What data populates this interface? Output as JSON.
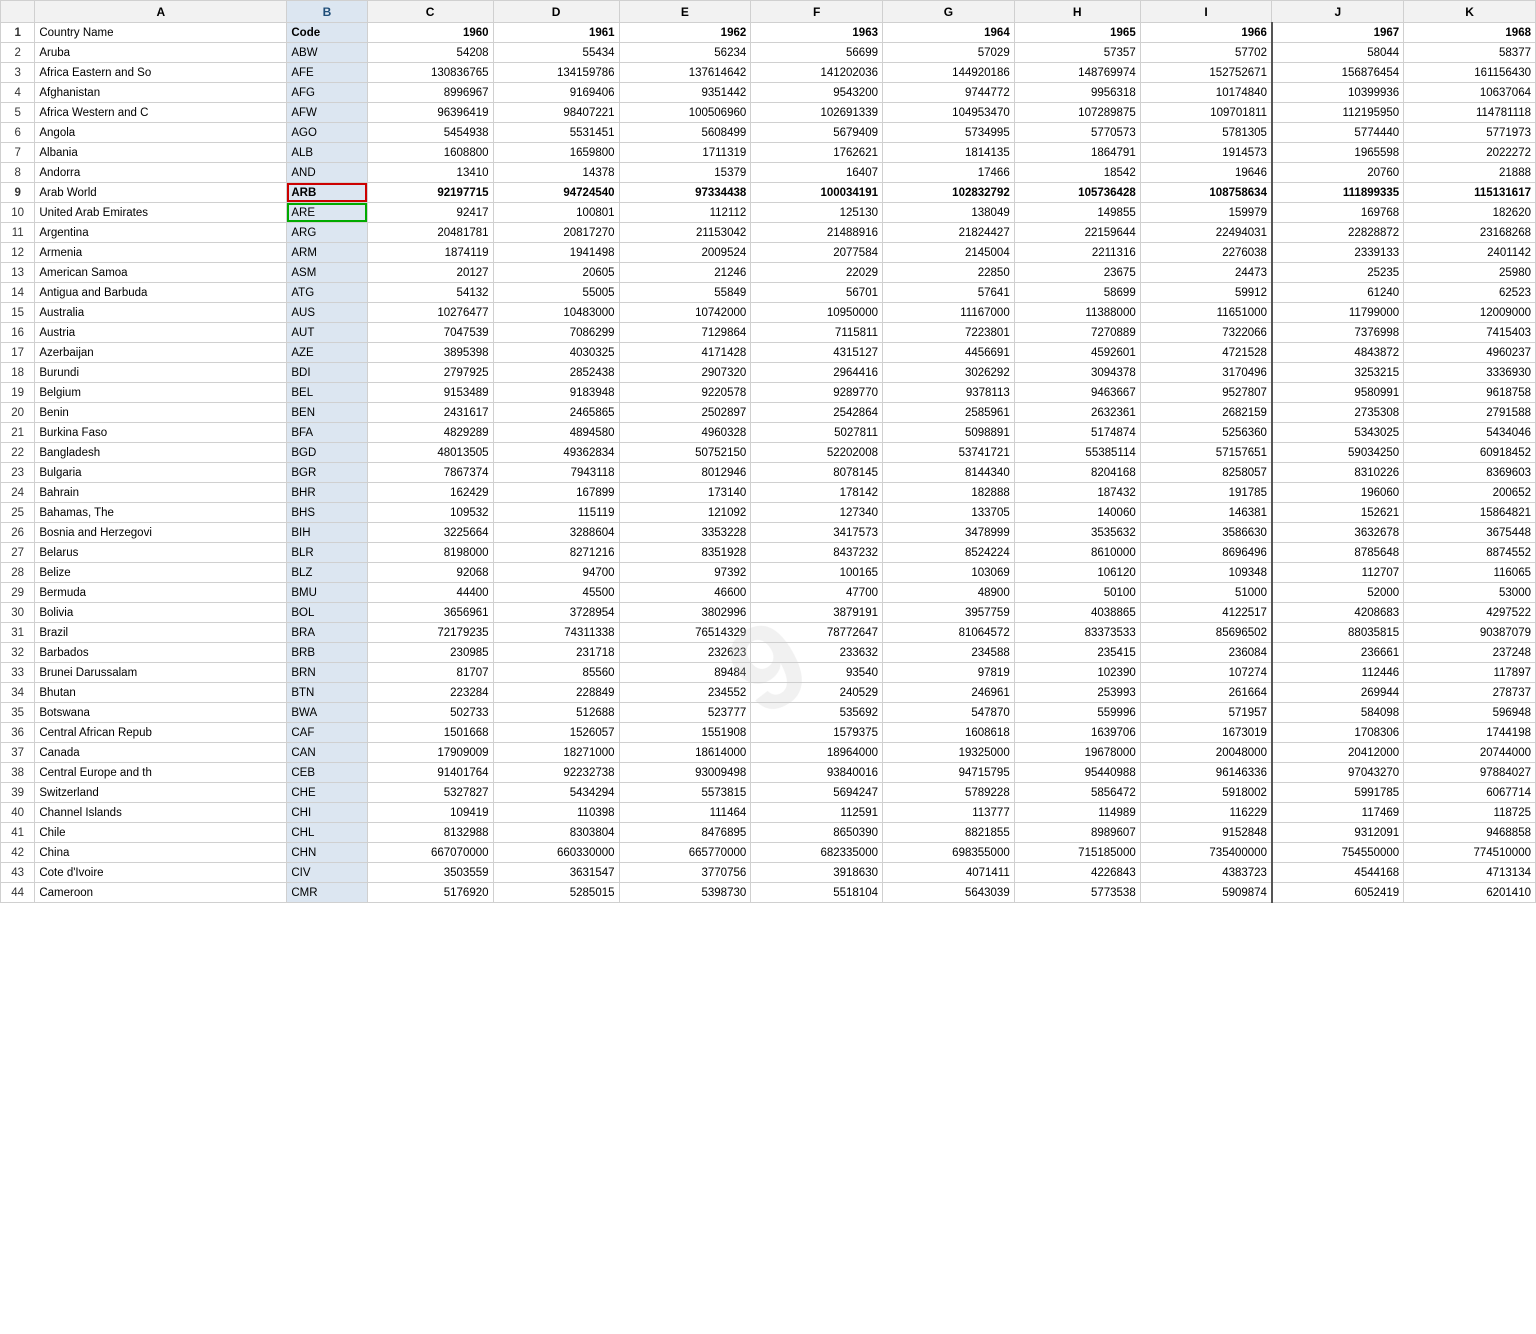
{
  "columns": {
    "rowNum": "#",
    "A": "A",
    "B": "B",
    "C": "C",
    "D": "D",
    "E": "E",
    "F": "F",
    "G": "G",
    "H": "H",
    "I": "I",
    "J": "J",
    "K": "K"
  },
  "rows": [
    {
      "num": 1,
      "A": "Country Name",
      "B": "Code",
      "C": "1960",
      "D": "1961",
      "E": "1962",
      "F": "1963",
      "G": "1964",
      "H": "1965",
      "I": "1966",
      "J": "1967",
      "K": "1968",
      "bold": true
    },
    {
      "num": 2,
      "A": "Aruba",
      "B": "ABW",
      "C": "54208",
      "D": "55434",
      "E": "56234",
      "F": "56699",
      "G": "57029",
      "H": "57357",
      "I": "57702",
      "J": "58044",
      "K": "58377"
    },
    {
      "num": 3,
      "A": "Africa Eastern and So",
      "B": "AFE",
      "C": "130836765",
      "D": "134159786",
      "E": "137614642",
      "F": "141202036",
      "G": "144920186",
      "H": "148769974",
      "I": "152752671",
      "J": "156876454",
      "K": "161156430"
    },
    {
      "num": 4,
      "A": "Afghanistan",
      "B": "AFG",
      "C": "8996967",
      "D": "9169406",
      "E": "9351442",
      "F": "9543200",
      "G": "9744772",
      "H": "9956318",
      "I": "10174840",
      "J": "10399936",
      "K": "10637064"
    },
    {
      "num": 5,
      "A": "Africa Western and C",
      "B": "AFW",
      "C": "96396419",
      "D": "98407221",
      "E": "100506960",
      "F": "102691339",
      "G": "104953470",
      "H": "107289875",
      "I": "109701811",
      "J": "112195950",
      "K": "114781118"
    },
    {
      "num": 6,
      "A": "Angola",
      "B": "AGO",
      "C": "5454938",
      "D": "5531451",
      "E": "5608499",
      "F": "5679409",
      "G": "5734995",
      "H": "5770573",
      "I": "5781305",
      "J": "5774440",
      "K": "5771973"
    },
    {
      "num": 7,
      "A": "Albania",
      "B": "ALB",
      "C": "1608800",
      "D": "1659800",
      "E": "1711319",
      "F": "1762621",
      "G": "1814135",
      "H": "1864791",
      "I": "1914573",
      "J": "1965598",
      "K": "2022272"
    },
    {
      "num": 8,
      "A": "Andorra",
      "B": "AND",
      "C": "13410",
      "D": "14378",
      "E": "15379",
      "F": "16407",
      "G": "17466",
      "H": "18542",
      "I": "19646",
      "J": "20760",
      "K": "21888"
    },
    {
      "num": 9,
      "A": "Arab World",
      "B": "ARB",
      "C": "92197715",
      "D": "94724540",
      "E": "97334438",
      "F": "100034191",
      "G": "102832792",
      "H": "105736428",
      "I": "108758634",
      "J": "111899335",
      "K": "115131617",
      "selectedB": true,
      "bold": true
    },
    {
      "num": 10,
      "A": "United Arab Emirates",
      "B": "ARE",
      "C": "92417",
      "D": "100801",
      "E": "112112",
      "F": "125130",
      "G": "138049",
      "H": "149855",
      "I": "159979",
      "J": "169768",
      "K": "182620",
      "selectedBGreen": true
    },
    {
      "num": 11,
      "A": "Argentina",
      "B": "ARG",
      "C": "20481781",
      "D": "20817270",
      "E": "21153042",
      "F": "21488916",
      "G": "21824427",
      "H": "22159644",
      "I": "22494031",
      "J": "22828872",
      "K": "23168268"
    },
    {
      "num": 12,
      "A": "Armenia",
      "B": "ARM",
      "C": "1874119",
      "D": "1941498",
      "E": "2009524",
      "F": "2077584",
      "G": "2145004",
      "H": "2211316",
      "I": "2276038",
      "J": "2339133",
      "K": "2401142"
    },
    {
      "num": 13,
      "A": "American Samoa",
      "B": "ASM",
      "C": "20127",
      "D": "20605",
      "E": "21246",
      "F": "22029",
      "G": "22850",
      "H": "23675",
      "I": "24473",
      "J": "25235",
      "K": "25980"
    },
    {
      "num": 14,
      "A": "Antigua and Barbuda",
      "B": "ATG",
      "C": "54132",
      "D": "55005",
      "E": "55849",
      "F": "56701",
      "G": "57641",
      "H": "58699",
      "I": "59912",
      "J": "61240",
      "K": "62523"
    },
    {
      "num": 15,
      "A": "Australia",
      "B": "AUS",
      "C": "10276477",
      "D": "10483000",
      "E": "10742000",
      "F": "10950000",
      "G": "11167000",
      "H": "11388000",
      "I": "11651000",
      "J": "11799000",
      "K": "12009000"
    },
    {
      "num": 16,
      "A": "Austria",
      "B": "AUT",
      "C": "7047539",
      "D": "7086299",
      "E": "7129864",
      "F": "7115811",
      "G": "7223801",
      "H": "7270889",
      "I": "7322066",
      "J": "7376998",
      "K": "7415403"
    },
    {
      "num": 17,
      "A": "Azerbaijan",
      "B": "AZE",
      "C": "3895398",
      "D": "4030325",
      "E": "4171428",
      "F": "4315127",
      "G": "4456691",
      "H": "4592601",
      "I": "4721528",
      "J": "4843872",
      "K": "4960237"
    },
    {
      "num": 18,
      "A": "Burundi",
      "B": "BDI",
      "C": "2797925",
      "D": "2852438",
      "E": "2907320",
      "F": "2964416",
      "G": "3026292",
      "H": "3094378",
      "I": "3170496",
      "J": "3253215",
      "K": "3336930"
    },
    {
      "num": 19,
      "A": "Belgium",
      "B": "BEL",
      "C": "9153489",
      "D": "9183948",
      "E": "9220578",
      "F": "9289770",
      "G": "9378113",
      "H": "9463667",
      "I": "9527807",
      "J": "9580991",
      "K": "9618758"
    },
    {
      "num": 20,
      "A": "Benin",
      "B": "BEN",
      "C": "2431617",
      "D": "2465865",
      "E": "2502897",
      "F": "2542864",
      "G": "2585961",
      "H": "2632361",
      "I": "2682159",
      "J": "2735308",
      "K": "2791588"
    },
    {
      "num": 21,
      "A": "Burkina Faso",
      "B": "BFA",
      "C": "4829289",
      "D": "4894580",
      "E": "4960328",
      "F": "5027811",
      "G": "5098891",
      "H": "5174874",
      "I": "5256360",
      "J": "5343025",
      "K": "5434046"
    },
    {
      "num": 22,
      "A": "Bangladesh",
      "B": "BGD",
      "C": "48013505",
      "D": "49362834",
      "E": "50752150",
      "F": "52202008",
      "G": "53741721",
      "H": "55385114",
      "I": "57157651",
      "J": "59034250",
      "K": "60918452"
    },
    {
      "num": 23,
      "A": "Bulgaria",
      "B": "BGR",
      "C": "7867374",
      "D": "7943118",
      "E": "8012946",
      "F": "8078145",
      "G": "8144340",
      "H": "8204168",
      "I": "8258057",
      "J": "8310226",
      "K": "8369603"
    },
    {
      "num": 24,
      "A": "Bahrain",
      "B": "BHR",
      "C": "162429",
      "D": "167899",
      "E": "173140",
      "F": "178142",
      "G": "182888",
      "H": "187432",
      "I": "191785",
      "J": "196060",
      "K": "200652"
    },
    {
      "num": 25,
      "A": "Bahamas, The",
      "B": "BHS",
      "C": "109532",
      "D": "115119",
      "E": "121092",
      "F": "127340",
      "G": "133705",
      "H": "140060",
      "I": "146381",
      "J": "152621",
      "K": "15864821"
    },
    {
      "num": 26,
      "A": "Bosnia and Herzegovi",
      "B": "BIH",
      "C": "3225664",
      "D": "3288604",
      "E": "3353228",
      "F": "3417573",
      "G": "3478999",
      "H": "3535632",
      "I": "3586630",
      "J": "3632678",
      "K": "3675448"
    },
    {
      "num": 27,
      "A": "Belarus",
      "B": "BLR",
      "C": "8198000",
      "D": "8271216",
      "E": "8351928",
      "F": "8437232",
      "G": "8524224",
      "H": "8610000",
      "I": "8696496",
      "J": "8785648",
      "K": "8874552"
    },
    {
      "num": 28,
      "A": "Belize",
      "B": "BLZ",
      "C": "92068",
      "D": "94700",
      "E": "97392",
      "F": "100165",
      "G": "103069",
      "H": "106120",
      "I": "109348",
      "J": "112707",
      "K": "116065"
    },
    {
      "num": 29,
      "A": "Bermuda",
      "B": "BMU",
      "C": "44400",
      "D": "45500",
      "E": "46600",
      "F": "47700",
      "G": "48900",
      "H": "50100",
      "I": "51000",
      "J": "52000",
      "K": "53000"
    },
    {
      "num": 30,
      "A": "Bolivia",
      "B": "BOL",
      "C": "3656961",
      "D": "3728954",
      "E": "3802996",
      "F": "3879191",
      "G": "3957759",
      "H": "4038865",
      "I": "4122517",
      "J": "4208683",
      "K": "4297522"
    },
    {
      "num": 31,
      "A": "Brazil",
      "B": "BRA",
      "C": "72179235",
      "D": "74311338",
      "E": "76514329",
      "F": "78772647",
      "G": "81064572",
      "H": "83373533",
      "I": "85696502",
      "J": "88035815",
      "K": "90387079"
    },
    {
      "num": 32,
      "A": "Barbados",
      "B": "BRB",
      "C": "230985",
      "D": "231718",
      "E": "232623",
      "F": "233632",
      "G": "234588",
      "H": "235415",
      "I": "236084",
      "J": "236661",
      "K": "237248"
    },
    {
      "num": 33,
      "A": "Brunei Darussalam",
      "B": "BRN",
      "C": "81707",
      "D": "85560",
      "E": "89484",
      "F": "93540",
      "G": "97819",
      "H": "102390",
      "I": "107274",
      "J": "112446",
      "K": "117897"
    },
    {
      "num": 34,
      "A": "Bhutan",
      "B": "BTN",
      "C": "223284",
      "D": "228849",
      "E": "234552",
      "F": "240529",
      "G": "246961",
      "H": "253993",
      "I": "261664",
      "J": "269944",
      "K": "278737"
    },
    {
      "num": 35,
      "A": "Botswana",
      "B": "BWA",
      "C": "502733",
      "D": "512688",
      "E": "523777",
      "F": "535692",
      "G": "547870",
      "H": "559996",
      "I": "571957",
      "J": "584098",
      "K": "596948"
    },
    {
      "num": 36,
      "A": "Central African Repub",
      "B": "CAF",
      "C": "1501668",
      "D": "1526057",
      "E": "1551908",
      "F": "1579375",
      "G": "1608618",
      "H": "1639706",
      "I": "1673019",
      "J": "1708306",
      "K": "1744198"
    },
    {
      "num": 37,
      "A": "Canada",
      "B": "CAN",
      "C": "17909009",
      "D": "18271000",
      "E": "18614000",
      "F": "18964000",
      "G": "19325000",
      "H": "19678000",
      "I": "20048000",
      "J": "20412000",
      "K": "20744000"
    },
    {
      "num": 38,
      "A": "Central Europe and th",
      "B": "CEB",
      "C": "91401764",
      "D": "92232738",
      "E": "93009498",
      "F": "93840016",
      "G": "94715795",
      "H": "95440988",
      "I": "96146336",
      "J": "97043270",
      "K": "97884027"
    },
    {
      "num": 39,
      "A": "Switzerland",
      "B": "CHE",
      "C": "5327827",
      "D": "5434294",
      "E": "5573815",
      "F": "5694247",
      "G": "5789228",
      "H": "5856472",
      "I": "5918002",
      "J": "5991785",
      "K": "6067714"
    },
    {
      "num": 40,
      "A": "Channel Islands",
      "B": "CHI",
      "C": "109419",
      "D": "110398",
      "E": "111464",
      "F": "112591",
      "G": "113777",
      "H": "114989",
      "I": "116229",
      "J": "117469",
      "K": "118725"
    },
    {
      "num": 41,
      "A": "Chile",
      "B": "CHL",
      "C": "8132988",
      "D": "8303804",
      "E": "8476895",
      "F": "8650390",
      "G": "8821855",
      "H": "8989607",
      "I": "9152848",
      "J": "9312091",
      "K": "9468858"
    },
    {
      "num": 42,
      "A": "China",
      "B": "CHN",
      "C": "667070000",
      "D": "660330000",
      "E": "665770000",
      "F": "682335000",
      "G": "698355000",
      "H": "715185000",
      "I": "735400000",
      "J": "754550000",
      "K": "774510000"
    },
    {
      "num": 43,
      "A": "Cote d'Ivoire",
      "B": "CIV",
      "C": "3503559",
      "D": "3631547",
      "E": "3770756",
      "F": "3918630",
      "G": "4071411",
      "H": "4226843",
      "I": "4383723",
      "J": "4544168",
      "K": "4713134"
    },
    {
      "num": 44,
      "A": "Cameroon",
      "B": "CMR",
      "C": "5176920",
      "D": "5285015",
      "E": "5398730",
      "F": "5518104",
      "G": "5643039",
      "H": "5773538",
      "I": "5909874",
      "J": "6052419",
      "K": "6201410"
    }
  ]
}
